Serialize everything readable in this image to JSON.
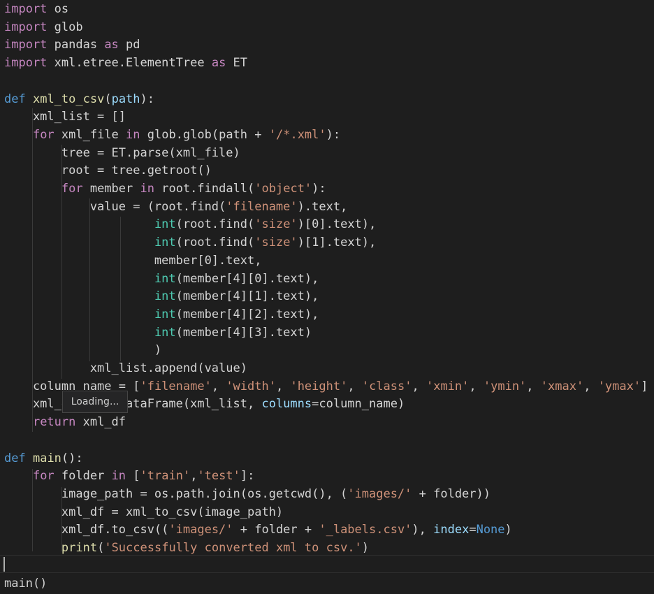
{
  "editor": {
    "language": "python",
    "theme": "dark",
    "lines": [
      {
        "tokens": [
          {
            "t": "import",
            "c": "kw"
          },
          {
            "t": " os",
            "c": "var"
          }
        ]
      },
      {
        "tokens": [
          {
            "t": "import",
            "c": "kw"
          },
          {
            "t": " glob",
            "c": "var"
          }
        ]
      },
      {
        "tokens": [
          {
            "t": "import",
            "c": "kw"
          },
          {
            "t": " pandas ",
            "c": "var"
          },
          {
            "t": "as",
            "c": "kw"
          },
          {
            "t": " pd",
            "c": "var"
          }
        ]
      },
      {
        "tokens": [
          {
            "t": "import",
            "c": "kw"
          },
          {
            "t": " xml.etree.ElementTree ",
            "c": "var"
          },
          {
            "t": "as",
            "c": "kw"
          },
          {
            "t": " ET",
            "c": "var"
          }
        ]
      },
      {
        "tokens": []
      },
      {
        "tokens": [
          {
            "t": "def",
            "c": "const"
          },
          {
            "t": " ",
            "c": "var"
          },
          {
            "t": "xml_to_csv",
            "c": "fn"
          },
          {
            "t": "(",
            "c": "var"
          },
          {
            "t": "path",
            "c": "param"
          },
          {
            "t": "):",
            "c": "var"
          }
        ]
      },
      {
        "tokens": [
          {
            "t": "    xml_list = []",
            "c": "var"
          }
        ]
      },
      {
        "tokens": [
          {
            "t": "    ",
            "c": "var"
          },
          {
            "t": "for",
            "c": "kw"
          },
          {
            "t": " xml_file ",
            "c": "var"
          },
          {
            "t": "in",
            "c": "kw"
          },
          {
            "t": " glob.glob(path + ",
            "c": "var"
          },
          {
            "t": "'/*.xml'",
            "c": "str"
          },
          {
            "t": "):",
            "c": "var"
          }
        ]
      },
      {
        "tokens": [
          {
            "t": "        tree = ET.parse(xml_file)",
            "c": "var"
          }
        ]
      },
      {
        "tokens": [
          {
            "t": "        root = tree.getroot()",
            "c": "var"
          }
        ]
      },
      {
        "tokens": [
          {
            "t": "        ",
            "c": "var"
          },
          {
            "t": "for",
            "c": "kw"
          },
          {
            "t": " member ",
            "c": "var"
          },
          {
            "t": "in",
            "c": "kw"
          },
          {
            "t": " root.findall(",
            "c": "var"
          },
          {
            "t": "'object'",
            "c": "str"
          },
          {
            "t": "):",
            "c": "var"
          }
        ]
      },
      {
        "tokens": [
          {
            "t": "            value = (root.find(",
            "c": "var"
          },
          {
            "t": "'filename'",
            "c": "str"
          },
          {
            "t": ").text,",
            "c": "var"
          }
        ]
      },
      {
        "tokens": [
          {
            "t": "                     ",
            "c": "var"
          },
          {
            "t": "int",
            "c": "bi"
          },
          {
            "t": "(root.find(",
            "c": "var"
          },
          {
            "t": "'size'",
            "c": "str"
          },
          {
            "t": ")[0].text),",
            "c": "var"
          }
        ]
      },
      {
        "tokens": [
          {
            "t": "                     ",
            "c": "var"
          },
          {
            "t": "int",
            "c": "bi"
          },
          {
            "t": "(root.find(",
            "c": "var"
          },
          {
            "t": "'size'",
            "c": "str"
          },
          {
            "t": ")[1].text),",
            "c": "var"
          }
        ]
      },
      {
        "tokens": [
          {
            "t": "                     member[0].text,",
            "c": "var"
          }
        ]
      },
      {
        "tokens": [
          {
            "t": "                     ",
            "c": "var"
          },
          {
            "t": "int",
            "c": "bi"
          },
          {
            "t": "(member[4][0].text),",
            "c": "var"
          }
        ]
      },
      {
        "tokens": [
          {
            "t": "                     ",
            "c": "var"
          },
          {
            "t": "int",
            "c": "bi"
          },
          {
            "t": "(member[4][1].text),",
            "c": "var"
          }
        ]
      },
      {
        "tokens": [
          {
            "t": "                     ",
            "c": "var"
          },
          {
            "t": "int",
            "c": "bi"
          },
          {
            "t": "(member[4][2].text),",
            "c": "var"
          }
        ]
      },
      {
        "tokens": [
          {
            "t": "                     ",
            "c": "var"
          },
          {
            "t": "int",
            "c": "bi"
          },
          {
            "t": "(member[4][3].text)",
            "c": "var"
          }
        ]
      },
      {
        "tokens": [
          {
            "t": "                     )",
            "c": "var"
          }
        ]
      },
      {
        "tokens": [
          {
            "t": "            xml_list.append(value)",
            "c": "var"
          }
        ]
      },
      {
        "tokens": [
          {
            "t": "    column_name = [",
            "c": "var"
          },
          {
            "t": "'filename'",
            "c": "str"
          },
          {
            "t": ", ",
            "c": "var"
          },
          {
            "t": "'width'",
            "c": "str"
          },
          {
            "t": ", ",
            "c": "var"
          },
          {
            "t": "'height'",
            "c": "str"
          },
          {
            "t": ", ",
            "c": "var"
          },
          {
            "t": "'class'",
            "c": "str"
          },
          {
            "t": ", ",
            "c": "var"
          },
          {
            "t": "'xmin'",
            "c": "str"
          },
          {
            "t": ", ",
            "c": "var"
          },
          {
            "t": "'ymin'",
            "c": "str"
          },
          {
            "t": ", ",
            "c": "var"
          },
          {
            "t": "'xmax'",
            "c": "str"
          },
          {
            "t": ", ",
            "c": "var"
          },
          {
            "t": "'ymax'",
            "c": "str"
          },
          {
            "t": "]",
            "c": "var"
          }
        ]
      },
      {
        "tokens": [
          {
            "t": "    xml_df = pd.DataFrame(xml_list, ",
            "c": "var"
          },
          {
            "t": "columns",
            "c": "param"
          },
          {
            "t": "=column_name)",
            "c": "var"
          }
        ]
      },
      {
        "tokens": [
          {
            "t": "    ",
            "c": "var"
          },
          {
            "t": "return",
            "c": "kw"
          },
          {
            "t": " xml_df",
            "c": "var"
          }
        ]
      },
      {
        "tokens": []
      },
      {
        "tokens": [
          {
            "t": "def",
            "c": "const"
          },
          {
            "t": " ",
            "c": "var"
          },
          {
            "t": "main",
            "c": "fn"
          },
          {
            "t": "():",
            "c": "var"
          }
        ]
      },
      {
        "tokens": [
          {
            "t": "    ",
            "c": "var"
          },
          {
            "t": "for",
            "c": "kw"
          },
          {
            "t": " folder ",
            "c": "var"
          },
          {
            "t": "in",
            "c": "kw"
          },
          {
            "t": " [",
            "c": "var"
          },
          {
            "t": "'train'",
            "c": "str"
          },
          {
            "t": ",",
            "c": "var"
          },
          {
            "t": "'test'",
            "c": "str"
          },
          {
            "t": "]:",
            "c": "var"
          }
        ]
      },
      {
        "tokens": [
          {
            "t": "        image_path = os.path.join(os.getcwd(), (",
            "c": "var"
          },
          {
            "t": "'images/'",
            "c": "str"
          },
          {
            "t": " + folder))",
            "c": "var"
          }
        ]
      },
      {
        "tokens": [
          {
            "t": "        xml_df = xml_to_csv(image_path)",
            "c": "var"
          }
        ]
      },
      {
        "tokens": [
          {
            "t": "        xml_df.to_csv((",
            "c": "var"
          },
          {
            "t": "'images/'",
            "c": "str"
          },
          {
            "t": " + folder + ",
            "c": "var"
          },
          {
            "t": "'_labels.csv'",
            "c": "str"
          },
          {
            "t": "), ",
            "c": "var"
          },
          {
            "t": "index",
            "c": "param"
          },
          {
            "t": "=",
            "c": "var"
          },
          {
            "t": "None",
            "c": "const"
          },
          {
            "t": ")",
            "c": "var"
          }
        ]
      },
      {
        "tokens": [
          {
            "t": "        ",
            "c": "var"
          },
          {
            "t": "print",
            "c": "fn"
          },
          {
            "t": "(",
            "c": "var"
          },
          {
            "t": "'Successfully converted xml to csv.'",
            "c": "str"
          },
          {
            "t": ")",
            "c": "var"
          }
        ]
      },
      {
        "tokens": []
      },
      {
        "tokens": [
          {
            "t": "main()",
            "c": "var"
          }
        ]
      }
    ]
  },
  "tooltip": {
    "text": "Loading..."
  }
}
